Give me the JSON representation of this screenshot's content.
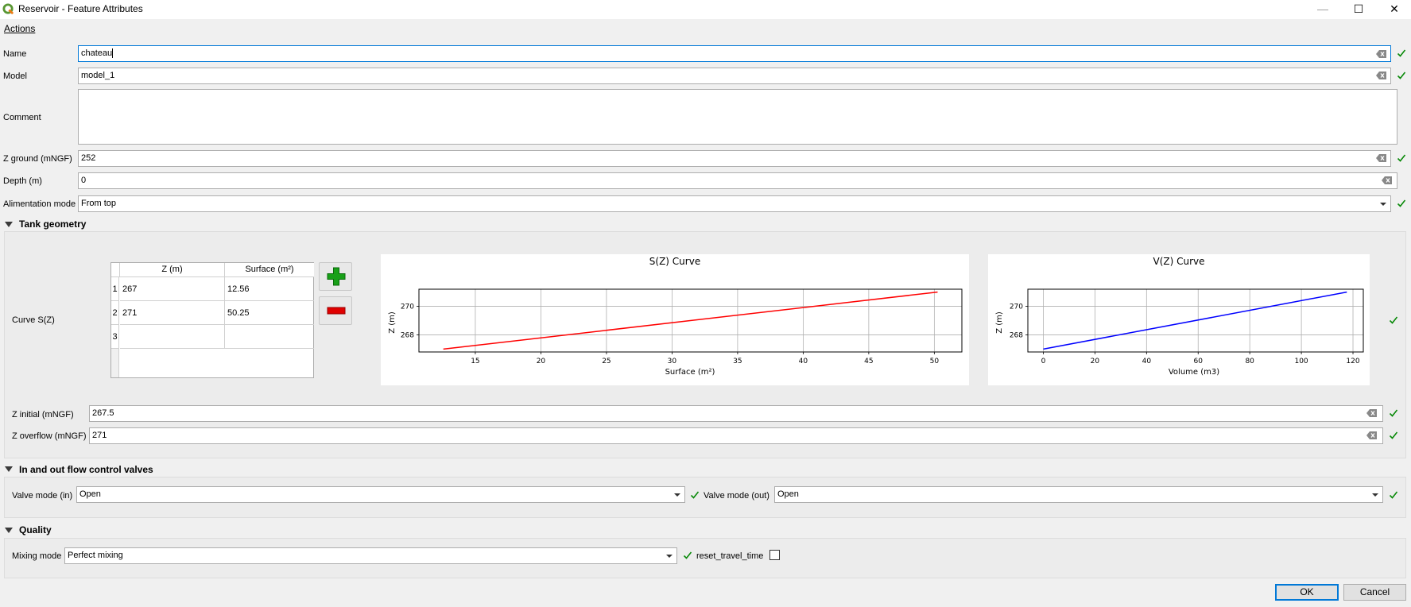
{
  "window": {
    "title": "Reservoir - Feature Attributes",
    "minimize": "—",
    "maximize": "☐",
    "close": "✕"
  },
  "menu": {
    "actions": "Actions"
  },
  "fields": {
    "name": {
      "label": "Name",
      "value": "chateau"
    },
    "model": {
      "label": "Model",
      "value": "model_1"
    },
    "comment": {
      "label": "Comment",
      "value": ""
    },
    "z_ground": {
      "label": "Z ground (mNGF)",
      "value": "252"
    },
    "depth": {
      "label": "Depth (m)",
      "value": "0"
    },
    "alimentation": {
      "label": "Alimentation mode",
      "value": "From top"
    }
  },
  "tank": {
    "title": "Tank geometry",
    "curve_label": "Curve S(Z)",
    "table": {
      "headers": [
        "Z (m)",
        "Surface (m²)"
      ],
      "rows": [
        {
          "n": "1",
          "z": "267",
          "s": "12.56"
        },
        {
          "n": "2",
          "z": "271",
          "s": "50.25"
        },
        {
          "n": "3",
          "z": "",
          "s": ""
        }
      ]
    },
    "z_initial": {
      "label": "Z initial (mNGF)",
      "value": "267.5"
    },
    "z_overflow": {
      "label": "Z overflow (mNGF)",
      "value": "271"
    }
  },
  "chart_data": [
    {
      "type": "line",
      "title": "S(Z) Curve",
      "xlabel": "Surface (m²)",
      "ylabel": "Z (m)",
      "x_ticks": [
        "15",
        "20",
        "25",
        "30",
        "35",
        "40",
        "45",
        "50"
      ],
      "y_ticks": [
        "268",
        "270"
      ],
      "xlim": [
        10.7,
        52.1
      ],
      "ylim": [
        266.8,
        271.2
      ],
      "grid": true,
      "color": "#ff0000",
      "series": [
        {
          "x": [
            12.56,
            50.25
          ],
          "y": [
            267,
            271
          ]
        }
      ]
    },
    {
      "type": "line",
      "title": "V(Z) Curve",
      "xlabel": "Volume (m3)",
      "ylabel": "Z (m)",
      "x_ticks": [
        "0",
        "20",
        "40",
        "60",
        "80",
        "100",
        "120"
      ],
      "y_ticks": [
        "268",
        "270"
      ],
      "xlim": [
        -6,
        124
      ],
      "ylim": [
        266.8,
        271.2
      ],
      "grid": true,
      "color": "#0000ff",
      "series": [
        {
          "x": [
            0,
            117.62
          ],
          "y": [
            267,
            271
          ]
        }
      ]
    }
  ],
  "valves": {
    "title": "In and out flow control valves",
    "in": {
      "label": "Valve mode (in)",
      "value": "Open"
    },
    "out": {
      "label": "Valve mode (out)",
      "value": "Open"
    }
  },
  "quality": {
    "title": "Quality",
    "mixing": {
      "label": "Mixing mode",
      "value": "Perfect mixing"
    },
    "reset_label": "reset_travel_time",
    "reset_checked": false
  },
  "buttons": {
    "ok": "OK",
    "cancel": "Cancel"
  },
  "colors": {
    "check": "#0a8a0a",
    "add": "#18a018",
    "remove": "#e00000",
    "focus": "#0078d7"
  }
}
